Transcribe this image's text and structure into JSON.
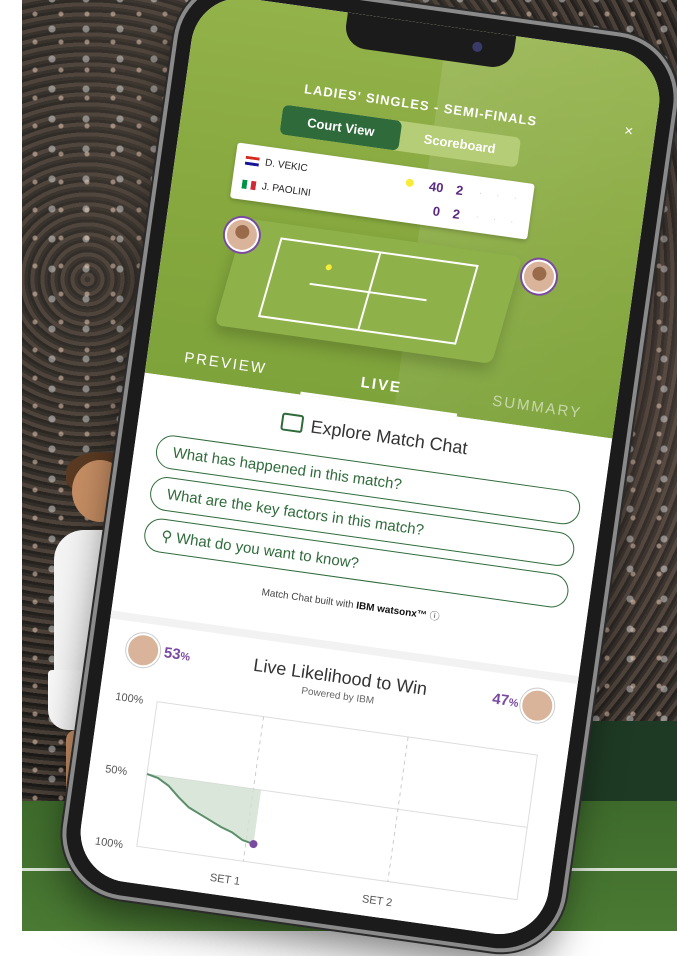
{
  "match": {
    "round": "LADIES' SINGLES - SEMI-FINALS",
    "close": "×",
    "view_toggle": {
      "active": "Court View",
      "inactive": "Scoreboard"
    }
  },
  "scoreboard": {
    "players": [
      {
        "name": "D. VEKIC",
        "points": "40",
        "games": "2",
        "serving": true,
        "flag": "croatia-flag"
      },
      {
        "name": "J. PAOLINI",
        "points": "0",
        "games": "2",
        "serving": false,
        "flag": "italy-flag"
      }
    ]
  },
  "tabs": {
    "preview": "PREVIEW",
    "live": "LIVE",
    "summary": "SUMMARY",
    "active": "LIVE"
  },
  "chat": {
    "title": "Explore Match Chat",
    "questions": [
      "What has happened in this match?",
      "What are the key factors in this match?"
    ],
    "input_placeholder": "What do you want to know?",
    "built_with_prefix": "Match Chat built with",
    "built_with_brand": "IBM watsonx™"
  },
  "likelihood": {
    "title": "Live Likelihood to Win",
    "powered_by": "Powered by IBM",
    "left_pct": "53",
    "right_pct": "47",
    "pct_sign": "%"
  },
  "chart_data": {
    "type": "area",
    "y_tick_labels": [
      "100%",
      "50%",
      "100%"
    ],
    "x_tick_labels": [
      "SET 1",
      "SET 2"
    ],
    "series": [
      {
        "points": [
          [
            0,
            50
          ],
          [
            0.1,
            48
          ],
          [
            0.2,
            43
          ],
          [
            0.3,
            35
          ],
          [
            0.4,
            28
          ],
          [
            0.5,
            24
          ],
          [
            0.6,
            20
          ],
          [
            0.7,
            16
          ],
          [
            0.8,
            13
          ],
          [
            0.9,
            8
          ],
          [
            1.0,
            6
          ]
        ]
      }
    ],
    "grid": true,
    "colors": {
      "line": "#5a8f6a",
      "fill": "#cfe0cf",
      "current": "#7a4aa0"
    }
  },
  "colors": {
    "accent": "#2f6b3a",
    "brand_green": "#86a83e",
    "purple": "#7a4aa0"
  }
}
